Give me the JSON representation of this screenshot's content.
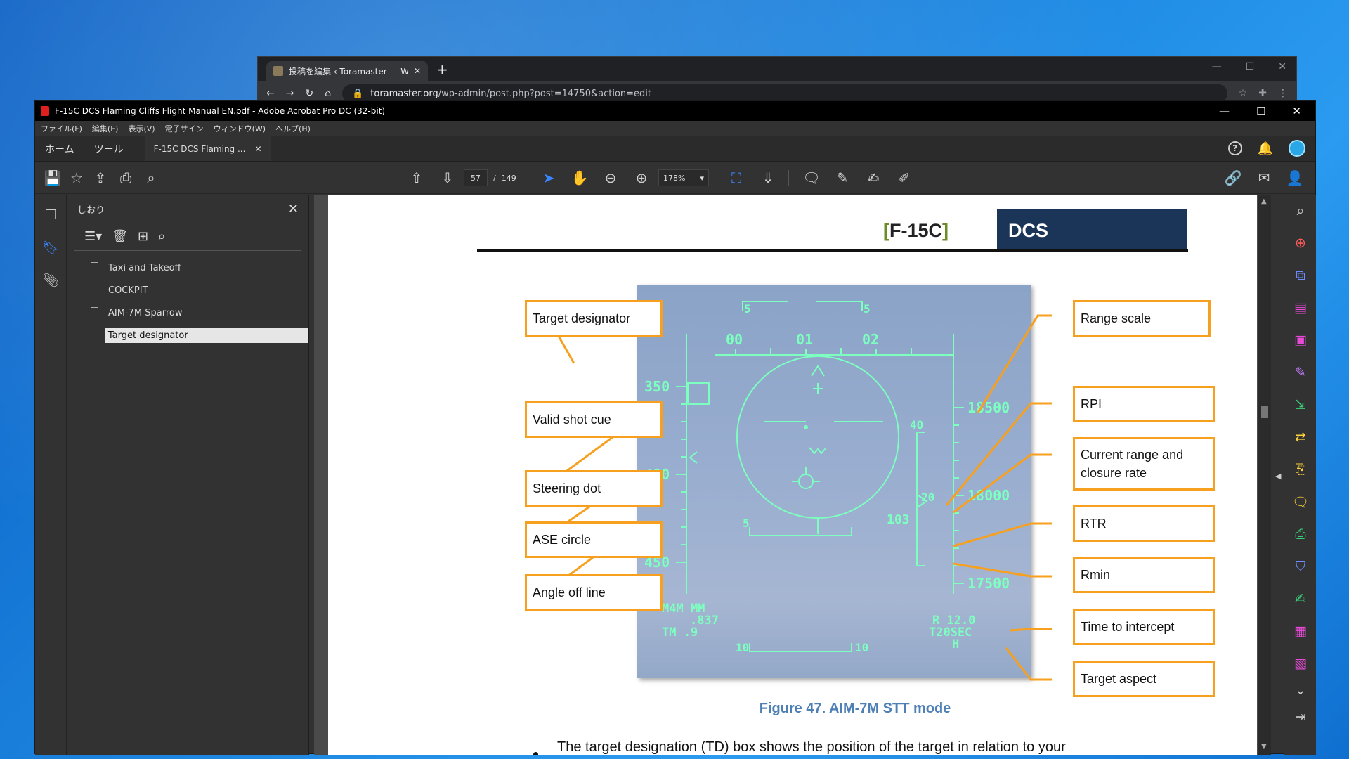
{
  "browser": {
    "tab_title": "投稿を編集 ‹ Toramaster — Word",
    "new_tab": "+",
    "url_host": "toramaster.org",
    "url_path": "/wp-admin/post.php?post=14750&action=edit"
  },
  "acrobat": {
    "window_title": "F-15C DCS Flaming Cliffs Flight Manual EN.pdf - Adobe Acrobat Pro DC (32-bit)",
    "menu": [
      "ファイル(F)",
      "編集(E)",
      "表示(V)",
      "電子サイン",
      "ウィンドウ(W)",
      "ヘルプ(H)"
    ],
    "tabs": {
      "home": "ホーム",
      "tools": "ツール",
      "doc": "F-15C DCS Flaming ..."
    },
    "toolbar": {
      "page_current": "57",
      "page_sep": "/",
      "page_total": "149",
      "zoom": "178%"
    },
    "bookmarks": {
      "title": "しおり",
      "items": [
        {
          "label": "Taxi and Takeoff"
        },
        {
          "label": "COCKPIT"
        },
        {
          "label": "AIM-7M Sparrow"
        },
        {
          "label": "Target designator"
        }
      ],
      "selected_index": 3
    }
  },
  "page": {
    "header_bracket_open": "[",
    "header_model": "F-15C",
    "header_bracket_close": "]",
    "header_dcs": "DCS",
    "caption": "Figure 47. AIM-7M STT mode",
    "body_line": "The target designation (TD) box shows the position of the target in relation to your",
    "callouts_left": [
      "Target designator",
      "Valid shot cue",
      "Steering dot",
      "ASE circle",
      "Angle off line"
    ],
    "callouts_right": [
      "Range scale",
      "RPI",
      "Current range and closure rate",
      "RTR",
      "Rmin",
      "Time to intercept",
      "Target aspect"
    ],
    "hud": {
      "heading_ticks": [
        "00",
        "01",
        "02"
      ],
      "left_scale": [
        "350",
        "400",
        "450"
      ],
      "right_scale": [
        "18500",
        "18000",
        "17500"
      ],
      "mark_5a": "5",
      "mark_5b": "5",
      "mark_5c": "5",
      "mark_10a": "10",
      "mark_10b": "10",
      "rpi_40": "40",
      "rpi_20": "20",
      "closure": "103",
      "bottom_left": [
        "M4M  MM",
        ".837",
        "TM  .9"
      ],
      "bottom_right": [
        "R 12.0",
        "T20SEC",
        "H"
      ]
    }
  },
  "colors": {
    "callout_border": "#f7a01f",
    "hud_symbology": "#7dffc0",
    "caption": "#4e7fb5",
    "dcs_bg": "#1a3557"
  }
}
